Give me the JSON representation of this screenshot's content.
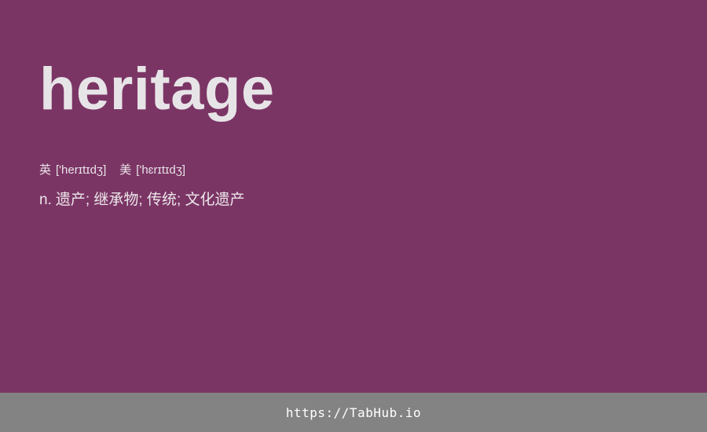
{
  "word": "heritage",
  "phonetics": {
    "uk_label": "英",
    "uk_ipa": "['herɪtɪdʒ]",
    "us_label": "美",
    "us_ipa": "['hɛrɪtɪdʒ]"
  },
  "definition": {
    "pos": "n.",
    "meaning": "遗产; 继承物; 传统; 文化遗产"
  },
  "footer": {
    "link_text": "https://TabHub.io"
  }
}
